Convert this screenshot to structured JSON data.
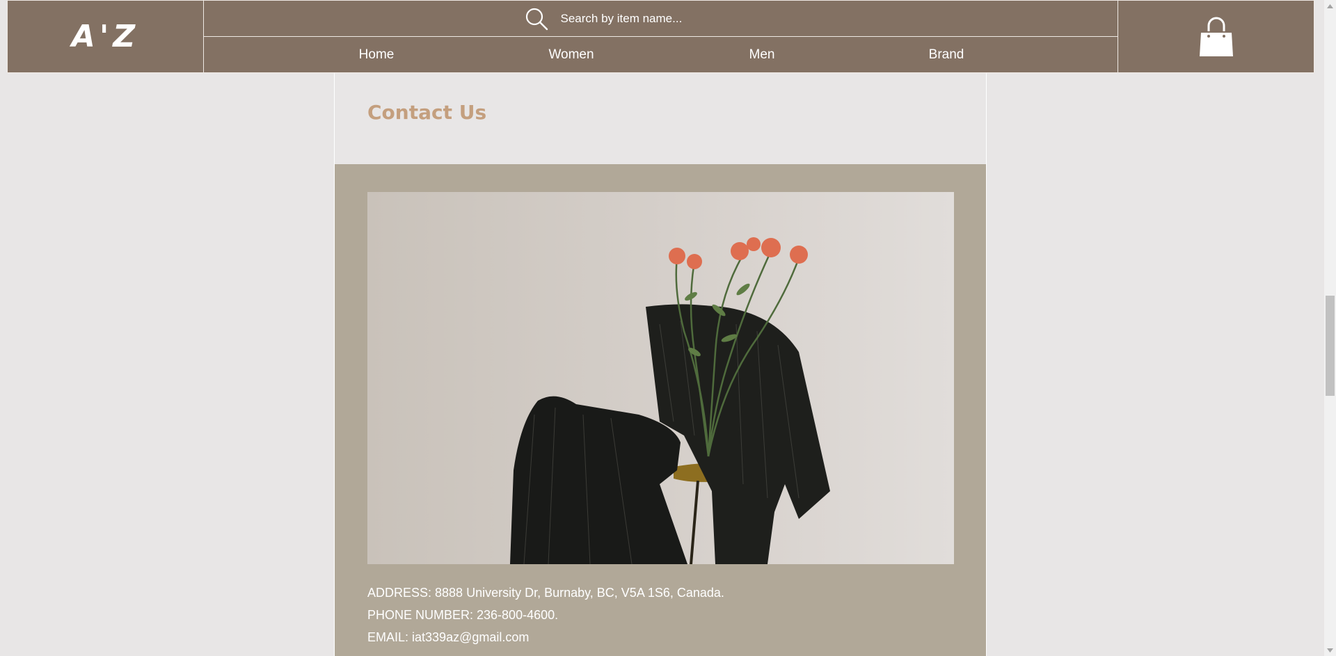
{
  "header": {
    "logo": "A'Z",
    "search": {
      "placeholder": "Search by item name...",
      "icon": "search-icon"
    },
    "nav": [
      {
        "label": "Home"
      },
      {
        "label": "Women"
      },
      {
        "label": "Men"
      },
      {
        "label": "Brand"
      }
    ],
    "cart_icon": "shopping-bag-icon"
  },
  "contact": {
    "title": "Contact Us",
    "address": "ADDRESS: 8888 University Dr, Burnaby, BC, V5A 1S6, Canada.",
    "phone": "PHONE NUMBER: 236-800-4600.",
    "email": "EMAIL: iat339az@gmail.com"
  },
  "colors": {
    "header_bg": "#837163",
    "page_bg": "#e8e6e6",
    "panel_bg": "#b1a898",
    "accent": "#c49f7e"
  }
}
